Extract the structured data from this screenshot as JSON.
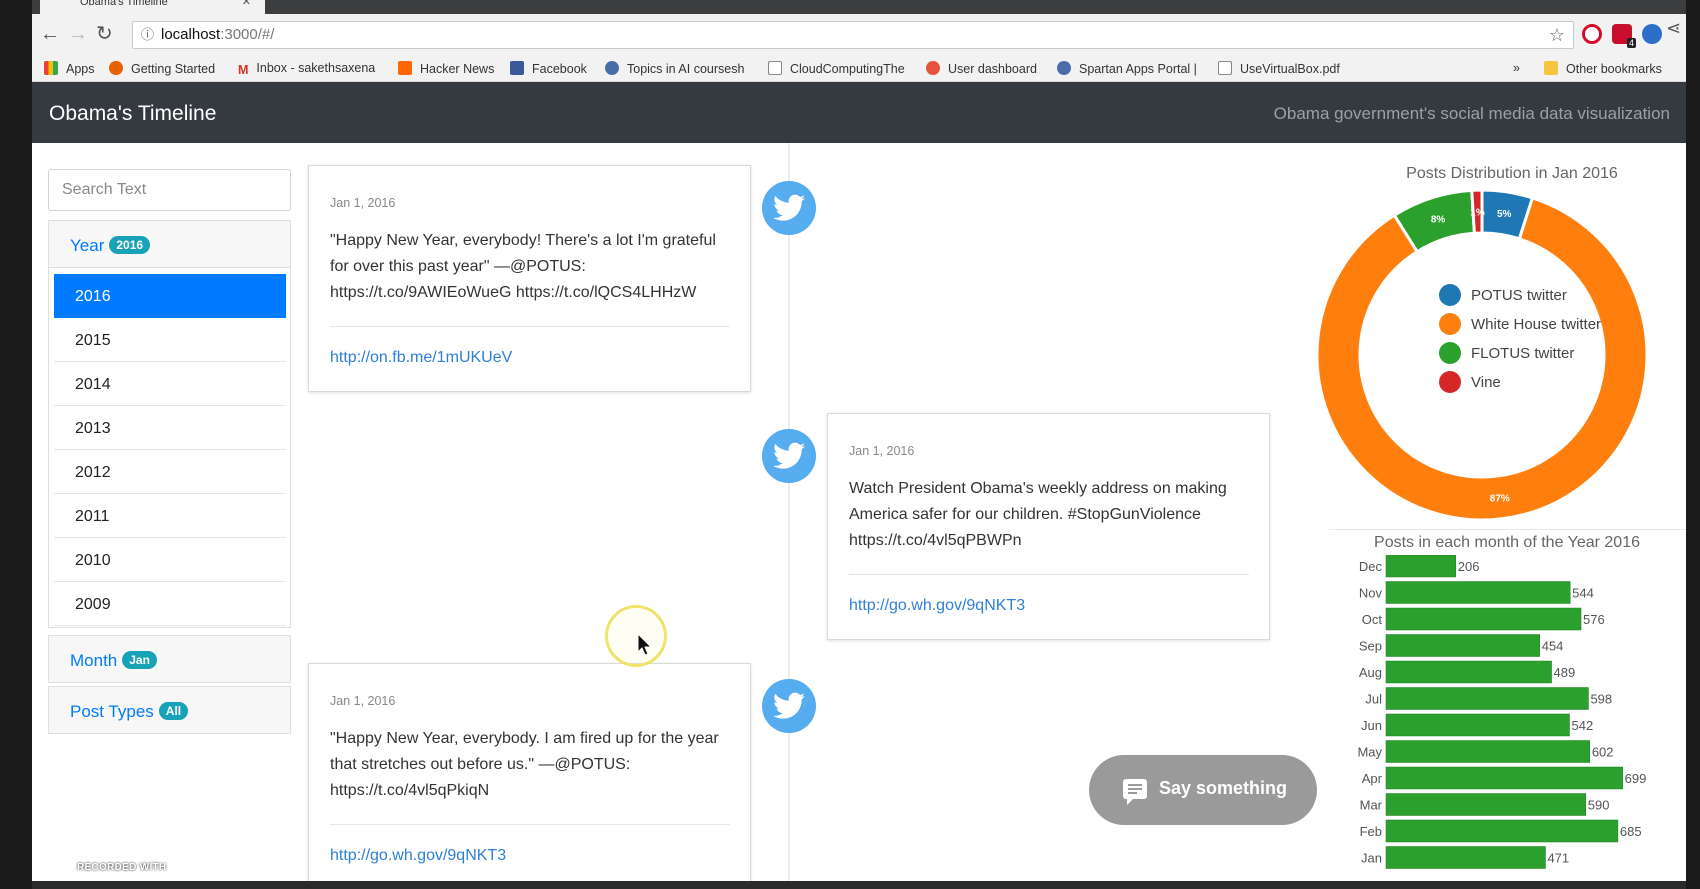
{
  "browser": {
    "tab_title": "Obama's Timeline",
    "url_host": "localhost",
    "url_path": ":3000/#/",
    "bookmarks": [
      "Apps",
      "Getting Started",
      "Inbox - sakethsaxena",
      "Hacker News",
      "Facebook",
      "Topics in AI coursesh",
      "CloudComputingThe",
      "User dashboard",
      "Spartan Apps Portal |",
      "UseVirtualBox.pdf"
    ],
    "other_bookmarks": "Other bookmarks",
    "overflow": "»",
    "ext_badge": "4"
  },
  "navbar": {
    "brand": "Obama's Timeline",
    "subtitle": "Obama government's social media data visualization"
  },
  "sidebar": {
    "search_placeholder": "Search Text",
    "year_label": "Year",
    "year_badge": "2016",
    "years": [
      "2016",
      "2015",
      "2014",
      "2013",
      "2012",
      "2011",
      "2010",
      "2009"
    ],
    "active_year": "2016",
    "month_label": "Month",
    "month_badge": "Jan",
    "types_label": "Post Types",
    "types_badge": "All"
  },
  "posts": [
    {
      "date": "Jan 1, 2016",
      "text": "\"Happy New Year, everybody! There's a lot I'm grateful for over this past year\" —@POTUS: https://t.co/9AWIEoWueG https://t.co/lQCS4LHHzW",
      "link": "http://on.fb.me/1mUKUeV"
    },
    {
      "date": "Jan 1, 2016",
      "text": "Watch President Obama's weekly address on making America safer for our children. #StopGunViolence https://t.co/4vl5qPBWPn",
      "link": "http://go.wh.gov/9qNKT3"
    },
    {
      "date": "Jan 1, 2016",
      "text": "\"Happy New Year, everybody. I am fired up for the year that stretches out before us.\" —@POTUS: https://t.co/4vl5qPkiqN",
      "link": "http://go.wh.gov/9qNKT3"
    }
  ],
  "say_button": "Say something",
  "watermark": "RECORDED WITH",
  "colors": {
    "potus": "#1f77b4",
    "white_house": "#ff7f0e",
    "flotus": "#2ca02c",
    "vine": "#d62728",
    "bar": "#2ca02c",
    "accent": "#007bff",
    "badge": "#17a2b8",
    "twitter": "#55acee"
  },
  "chart_data": [
    {
      "type": "pie",
      "title": "Posts Distribution in Jan 2016",
      "categories": [
        "POTUS twitter",
        "White House twitter",
        "FLOTUS twitter",
        "Vine"
      ],
      "values": [
        5,
        87,
        8,
        1
      ],
      "labels": [
        "5%",
        "87%",
        "8%",
        "1%"
      ],
      "legend": "center"
    },
    {
      "type": "bar",
      "orientation": "horizontal",
      "title": "Posts in each month of the Year 2016",
      "categories": [
        "Dec",
        "Nov",
        "Oct",
        "Sep",
        "Aug",
        "Jul",
        "Jun",
        "May",
        "Apr",
        "Mar",
        "Feb",
        "Jan"
      ],
      "values": [
        206,
        544,
        576,
        454,
        489,
        598,
        542,
        602,
        699,
        590,
        685,
        471
      ],
      "xlim": [
        0,
        700
      ]
    }
  ]
}
